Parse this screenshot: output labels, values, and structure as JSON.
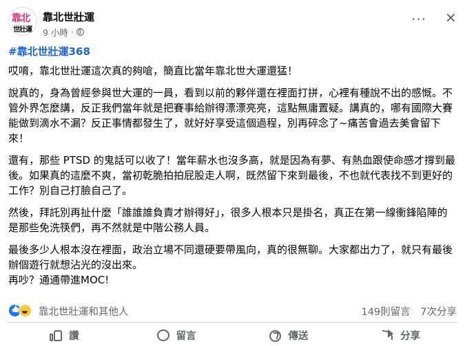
{
  "header": {
    "avatar_line1": "靠北",
    "avatar_line2": "世壯運",
    "page_name": "靠北世壯運",
    "time": "9 小時",
    "dot": "·",
    "more_icon": "more-horizontal-icon",
    "close_icon": "close-icon"
  },
  "post": {
    "hashtag": "#靠北世壯運368",
    "paragraphs": [
      "哎唷，靠北世壯運這次真的夠嗆，簡直比當年靠北世大運還猛！",
      "說真的，身為曾經參與世大運的一員，看到以前的夥伴還在裡面打拼，心裡有種說不出的感慨。不管外界怎麼講，反正我們當年就是把賽事給辦得漂漂亮亮，這點無庸置疑。講真的，哪有國際大賽能做到滴水不漏？反正事情都發生了，就好好享受這個過程，別再碎念了~痛苦會過去美會留下來！",
      "還有，那些 PTSD 的鬼話可以收了！當年薪水也沒多高，就是因為有夢、有熱血跟使命感才撐到最後。如果真的這麼不爽，當初乾脆拍拍屁股走人啊，既然留下來到最後，不也就代表找不到更好的工作？別自己打臉自己了。",
      "然後，拜託別再扯什麼「誰誰誰負責才辦得好」，很多人根本只是掛名，真正在第一線衝鋒陷陣的是那些免洗筷們，再不然就是中階公務人員。",
      "最後多少人根本沒在裡面，政治立場不同還硬要帶風向，真的很無聊。大家都出力了，就只有最後辦個遊行就想沾光的沒出來。",
      "再吵？通通帶進MOC!"
    ]
  },
  "reactions": {
    "names": "靠北世壯運和其他人",
    "comments": "149則留言",
    "shares": "7次分享",
    "icons": [
      "like-icon",
      "haha-icon"
    ]
  },
  "actions": {
    "like": "讚",
    "comment": "留言",
    "send": "傳送",
    "share": "分享"
  },
  "colors": {
    "hashtag": "#1e64d6",
    "secondary_text": "#65676b",
    "like_blue": "#1877f2"
  }
}
